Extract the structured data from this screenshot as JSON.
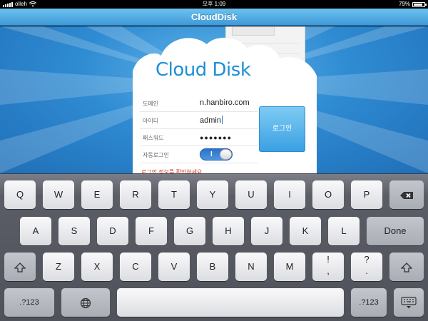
{
  "status_bar": {
    "carrier": "olleh",
    "time": "오후 1:09",
    "battery": "79%"
  },
  "app": {
    "title": "CloudDisk",
    "logo": "Cloud Disk"
  },
  "login": {
    "domain_label": "도메인",
    "domain_value": "n.hanbiro.com",
    "id_label": "아이디",
    "id_value": "admin",
    "password_label": "패스워드",
    "password_value": "●●●●●●●",
    "auto_label": "자동로그인",
    "auto_state": "I",
    "login_button": "로그인",
    "warning": "로그인 정보를 확인하세요"
  },
  "keyboard": {
    "row1": [
      "Q",
      "W",
      "E",
      "R",
      "T",
      "Y",
      "U",
      "I",
      "O",
      "P"
    ],
    "row2": [
      "A",
      "S",
      "D",
      "F",
      "G",
      "H",
      "J",
      "K",
      "L"
    ],
    "row3": [
      "Z",
      "X",
      "C",
      "V",
      "B",
      "N",
      "M"
    ],
    "done": "Done",
    "numbers_left": ".?123",
    "numbers_right": ".?123",
    "excl_top": "!",
    "excl_bot": ",",
    "quest_top": "?",
    "quest_bot": "."
  },
  "icons": [
    "wifi-icon",
    "battery-icon",
    "backspace-icon",
    "shift-icon",
    "globe-icon",
    "hide-keyboard-icon"
  ],
  "colors": {
    "title_bar": "#4aa6e0",
    "logo_blue": "#1d8fd6",
    "button_blue": "#3aa0e2",
    "keyboard_bg": "#53565e"
  }
}
